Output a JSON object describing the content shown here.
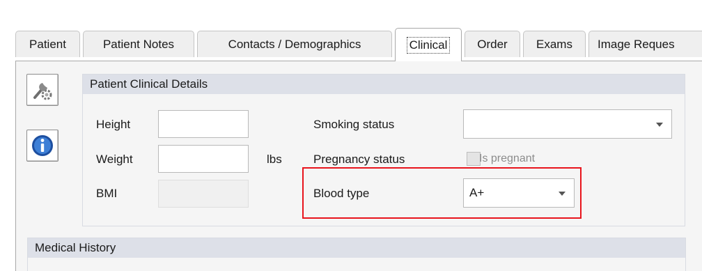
{
  "tabs": [
    {
      "label": "Patient",
      "active": false
    },
    {
      "label": "Patient Notes",
      "active": false
    },
    {
      "label": "Contacts / Demographics",
      "active": false
    },
    {
      "label": "Clinical",
      "active": true
    },
    {
      "label": "Order",
      "active": false
    },
    {
      "label": "Exams",
      "active": false
    },
    {
      "label": "Image Reques",
      "active": false
    }
  ],
  "side_buttons": {
    "tools_icon": "wrench-gear-icon",
    "info_icon": "info-icon"
  },
  "clinical_details": {
    "title": "Patient Clinical Details",
    "height": {
      "label": "Height",
      "value": ""
    },
    "weight": {
      "label": "Weight",
      "value": "",
      "unit": "lbs"
    },
    "bmi": {
      "label": "BMI",
      "value": ""
    },
    "smoking_status": {
      "label": "Smoking status",
      "value": ""
    },
    "pregnancy_status": {
      "label": "Pregnancy status",
      "checkbox_label": "Is pregnant",
      "checked": false
    },
    "blood_type": {
      "label": "Blood type",
      "value": "A+"
    }
  },
  "medical_history": {
    "title": "Medical History"
  },
  "colors": {
    "highlight": "#e8141c",
    "panel_header": "#dde0e8",
    "content_bg": "#f5f5f5"
  }
}
